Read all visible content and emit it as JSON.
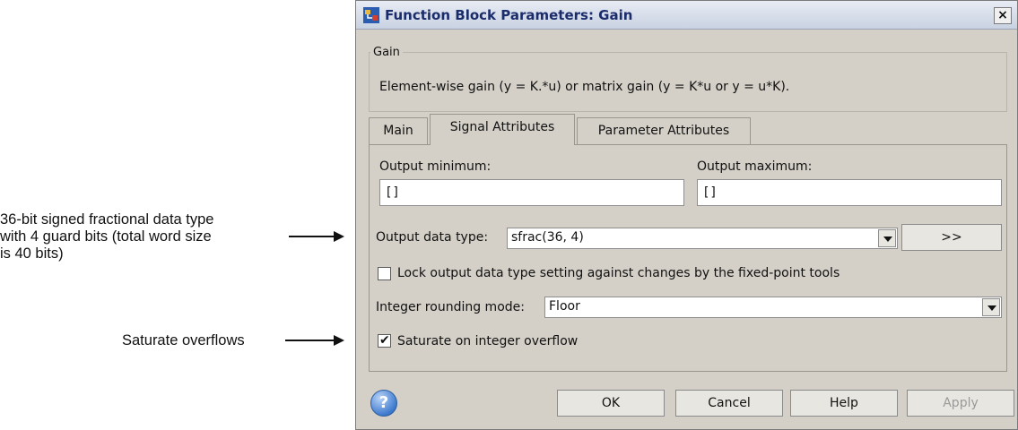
{
  "annotations": {
    "data_type_lines": [
      "36-bit signed fractional data type",
      "with 4 guard bits (total word size",
      "is 40 bits)"
    ],
    "saturate_label": "Saturate overflows"
  },
  "window": {
    "title": "Function Block Parameters: Gain",
    "close_glyph": "×",
    "icon": "simulink-block-icon"
  },
  "block": {
    "group_label": "Gain",
    "description": "Element-wise gain (y = K.*u) or matrix gain (y = K*u or y = u*K)."
  },
  "tabs": [
    {
      "label": "Main"
    },
    {
      "label": "Signal Attributes"
    },
    {
      "label": "Parameter Attributes"
    }
  ],
  "active_tab": "Signal Attributes",
  "signal_attributes": {
    "output_min_label": "Output minimum:",
    "output_min_value": "[]",
    "output_max_label": "Output maximum:",
    "output_max_value": "[]",
    "output_type_label": "Output data type:",
    "output_type_value": "sfrac(36, 4)",
    "type_assistant_button": ">>",
    "lock_label": "Lock output data type setting against changes by the fixed-point tools",
    "lock_checked": false,
    "rounding_label": "Integer rounding mode:",
    "rounding_value": "Floor",
    "saturate_label": "Saturate on integer overflow",
    "saturate_checked": true
  },
  "buttons": {
    "ok": "OK",
    "cancel": "Cancel",
    "help": "Help",
    "apply": "Apply",
    "help_icon_glyph": "?"
  }
}
